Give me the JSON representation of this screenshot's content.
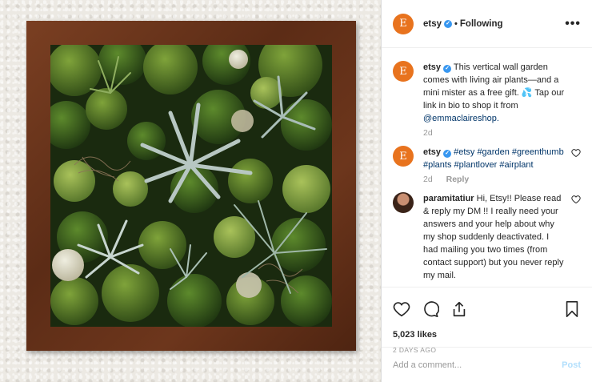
{
  "post": {
    "photo_alt": "",
    "header": {
      "avatar_letter": "E",
      "username": "etsy",
      "separator": "•",
      "follow_status": "Following",
      "more_icon": "more-options-icon"
    },
    "comments": [
      {
        "avatar_letter": "E",
        "username": "etsy",
        "text": "This vertical wall garden comes with living air plants—and a mini mister as a free gift. 💦 Tap our link in bio to shop it from ",
        "mention": "@emmaclaireshop.",
        "time": "2d",
        "reply": ""
      },
      {
        "avatar_letter": "E",
        "username": "etsy",
        "hashtags": "#etsy #garden #greenthumb #plants #plantlover #airplant",
        "time": "2d",
        "reply": "Reply"
      },
      {
        "username": "paramitatiur",
        "text": "Hi, Etsy!! Please read & reply my DM !! I really need your answers and your help about why my shop suddenly deactivated. I had mailing you two times (from contact support) but you never reply my mail."
      }
    ],
    "actions": {
      "like_icon": "heart-icon",
      "comment_icon": "comment-icon",
      "share_icon": "share-icon",
      "save_icon": "bookmark-icon"
    },
    "likes": "5,023 likes",
    "date": "2 DAYS AGO",
    "add_comment": {
      "placeholder": "Add a comment...",
      "post_label": "Post"
    }
  },
  "colors": {
    "etsy_orange": "#e8731e",
    "verified_blue": "#3897f0",
    "link_blue": "#003569",
    "post_disabled": "#b2dffc"
  }
}
